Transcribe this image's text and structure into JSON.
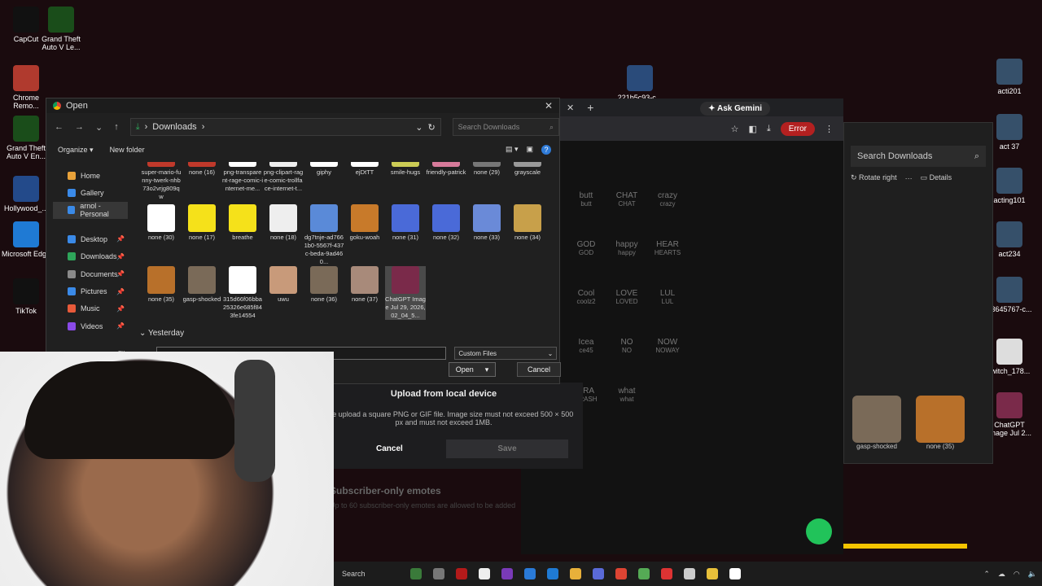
{
  "desktop": {
    "icons": [
      {
        "label": "CapCut",
        "color": "#111111"
      },
      {
        "label": "Grand Theft Auto V Le...",
        "color": "#1a4d1a"
      },
      {
        "label": "Chrome Remo...",
        "color": "#b03a2e"
      },
      {
        "label": "Grand Theft Auto V En...",
        "color": "#1a4d1a"
      },
      {
        "label": "Hollywood_...",
        "color": "#234a8a"
      },
      {
        "label": "Microsoft Edge",
        "color": "#1f7ad4"
      },
      {
        "label": "TikTok",
        "color": "#111111"
      },
      {
        "label": "221b5c93-c...",
        "color": "#2a4b7a"
      },
      {
        "label": "acti201",
        "color": "#36506a"
      },
      {
        "label": "act 37",
        "color": "#36506a"
      },
      {
        "label": "acting101",
        "color": "#36506a"
      },
      {
        "label": "act234",
        "color": "#36506a"
      },
      {
        "label": "63645767-c...",
        "color": "#36506a"
      },
      {
        "label": "twitch_178...",
        "color": "#dddddd"
      },
      {
        "label": "ChatGPT Image Jul 2...",
        "color": "#7a2a4a"
      }
    ]
  },
  "browser": {
    "ask_gemini": "Ask Gemini",
    "error_label": "Error",
    "emotes": [
      {
        "code": "butt",
        "label": "butt"
      },
      {
        "code": "CHAT",
        "label": "CHAT"
      },
      {
        "code": "crazy",
        "label": "crazy"
      },
      {
        "code": "GOD",
        "label": "GOD"
      },
      {
        "code": "happy",
        "label": "happy"
      },
      {
        "code": "HEAR",
        "label": "HEARTS"
      },
      {
        "code": "Cool",
        "label": "coolz2"
      },
      {
        "code": "LOVE",
        "label": "LOVED"
      },
      {
        "code": "LUL",
        "label": "LUL"
      },
      {
        "code": "Icea",
        "label": "ce45"
      },
      {
        "code": "NO",
        "label": "NO"
      },
      {
        "code": "NOW",
        "label": "NOWAY"
      },
      {
        "code": "TRA",
        "label": "TRASH"
      },
      {
        "code": "what",
        "label": "what"
      }
    ],
    "modal": {
      "title": "Upload from local device",
      "description": "Please upload a square PNG or GIF file. Image size must not exceed 500 × 500 px and must not exceed 1MB.",
      "cancel": "Cancel",
      "save": "Save"
    },
    "subscriber_title": "Subscriber-only emotes",
    "subscriber_desc": "Up to 60 subscriber-only emotes are allowed to be added"
  },
  "explorer_bg": {
    "search_placeholder": "Search Downloads",
    "rotate": "Rotate right",
    "details": "Details",
    "thumbs": [
      {
        "label": "gasp-shocked",
        "color": "#7a6a58"
      },
      {
        "label": "none (35)",
        "color": "#b8702a"
      }
    ]
  },
  "dialog": {
    "title": "Open",
    "path": "Downloads",
    "search_placeholder": "Search Downloads",
    "organize": "Organize",
    "new_folder": "New folder",
    "sidebar": [
      {
        "label": "Home",
        "color": "#e8a23a",
        "pin": false
      },
      {
        "label": "Gallery",
        "color": "#3a8ae8",
        "pin": false
      },
      {
        "label": "arnol - Personal",
        "color": "#3a8ae8",
        "pin": false,
        "selected": true
      },
      {
        "label": "Desktop",
        "color": "#3a8ae8",
        "pin": true
      },
      {
        "label": "Downloads",
        "color": "#2ea55a",
        "pin": true
      },
      {
        "label": "Documents",
        "color": "#8a8a8a",
        "pin": true
      },
      {
        "label": "Pictures",
        "color": "#3a8ae8",
        "pin": true
      },
      {
        "label": "Music",
        "color": "#e85a3a",
        "pin": true
      },
      {
        "label": "Videos",
        "color": "#8a4ae8",
        "pin": true
      }
    ],
    "files_row1": [
      {
        "name": "super-mario-funny-twerk-nhb73o2vrjg809qw",
        "color": "#c0392b"
      },
      {
        "name": "none (16)",
        "color": "#c0392b"
      },
      {
        "name": "png-transparent-rage-comic-internet-me...",
        "color": "#ffffff"
      },
      {
        "name": "png-clipart-rage-comic-trollface-internet-t...",
        "color": "#eeeeee"
      },
      {
        "name": "giphy",
        "color": "#ffffff"
      },
      {
        "name": "ejDtTT",
        "color": "#ffffff"
      },
      {
        "name": "smile-hugs",
        "color": "#cccc55"
      },
      {
        "name": "friendly-patrick",
        "color": "#d77a9a"
      },
      {
        "name": "none (29)",
        "color": "#777777"
      },
      {
        "name": "grayscale",
        "color": "#999999"
      }
    ],
    "files_row2": [
      {
        "name": "none (30)",
        "color": "#ffffff"
      },
      {
        "name": "none (17)",
        "color": "#f5e11a"
      },
      {
        "name": "breathe",
        "color": "#f5e11a"
      },
      {
        "name": "none (18)",
        "color": "#eeeeee"
      },
      {
        "name": "dg7tnje-ad7661b0-5567f-437c-beda-9ad460...",
        "color": "#5a8ad8"
      },
      {
        "name": "goku-woah",
        "color": "#c87a2a"
      },
      {
        "name": "none (31)",
        "color": "#4a6ad8"
      },
      {
        "name": "none (32)",
        "color": "#4a6ad8"
      },
      {
        "name": "none (33)",
        "color": "#6a8ad8"
      },
      {
        "name": "none (34)",
        "color": "#c8a04a"
      }
    ],
    "files_row3": [
      {
        "name": "none (35)",
        "color": "#b8702a"
      },
      {
        "name": "gasp-shocked",
        "color": "#7a6a58"
      },
      {
        "name": "315d66f06bba25326e685f843fe14554",
        "color": "#ffffff"
      },
      {
        "name": "uwu",
        "color": "#c89a7a"
      },
      {
        "name": "none (36)",
        "color": "#7a6a58"
      },
      {
        "name": "none (37)",
        "color": "#a88a7a"
      },
      {
        "name": "ChatGPT Image Jul 29, 2026, 02_04_5...",
        "color": "#7a2a4a",
        "selected": true
      }
    ],
    "group_label": "Yesterday",
    "filename_label": "File name:",
    "filetype": "Custom Files",
    "open": "Open",
    "cancel": "Cancel"
  },
  "taskbar": {
    "search": "Search",
    "icons": [
      "#3a7a3a",
      "#777777",
      "#b31a1a",
      "#eeeeee",
      "#7a3ab8",
      "#2a7ad8",
      "#1f7ad4",
      "#e8b03a",
      "#5a6ad8",
      "#dd4433",
      "#55aa55",
      "#dd3333",
      "#cccccc",
      "#e8c03a",
      "#ffffff"
    ]
  }
}
